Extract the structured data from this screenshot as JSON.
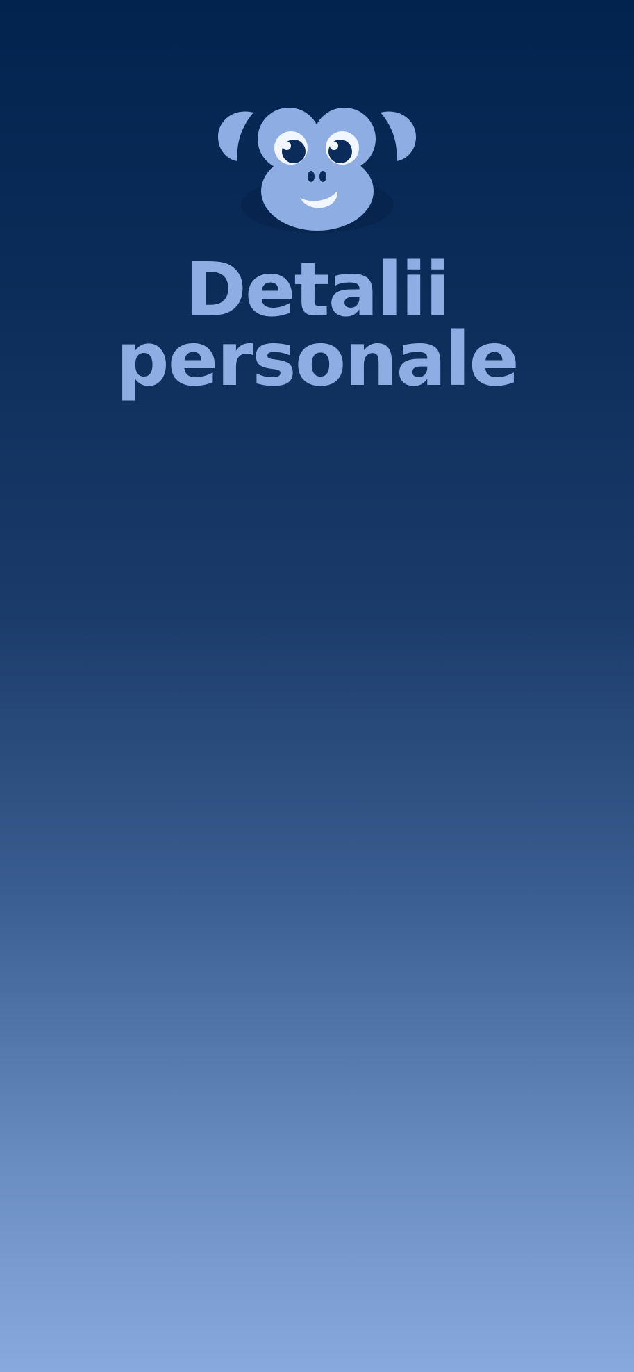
{
  "logo": {
    "icon": "monkey-face-icon",
    "color": "#8eaee3",
    "dark_color": "#0b2c5b",
    "highlight_color": "#f2f6ff"
  },
  "page": {
    "title_line1": "Detalii",
    "title_line2": "personale",
    "title_color": "#8eaee3"
  },
  "background": {
    "top_color": "#03234f",
    "bottom_color": "#88a9de"
  }
}
